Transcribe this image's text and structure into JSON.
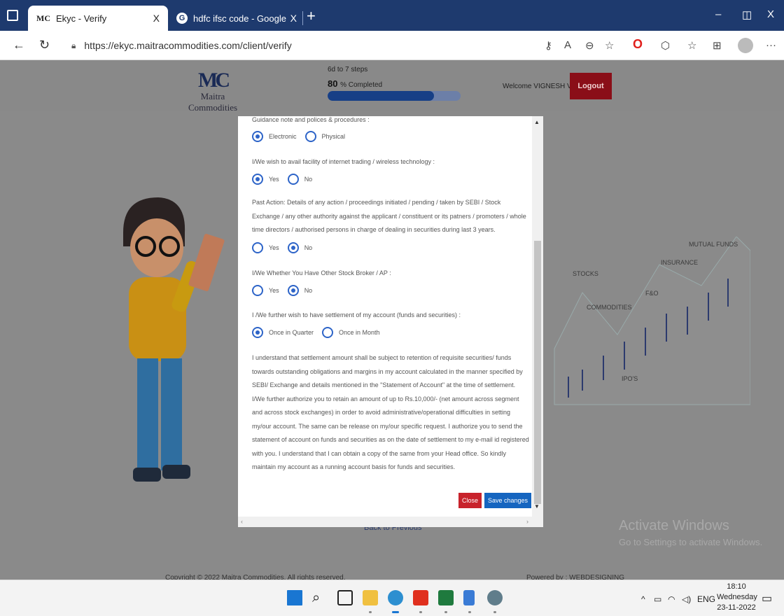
{
  "browser": {
    "tabs": [
      {
        "favicon": "MC",
        "title": "Ekyc - Verify",
        "close": "X",
        "active": true
      },
      {
        "favicon": "G",
        "title": "hdfc ifsc code - Google Search",
        "close": "X",
        "active": false
      }
    ],
    "new_tab": "+",
    "window_controls": {
      "minimize": "–",
      "restore": "◫",
      "close": "X"
    },
    "url": "https://ekyc.maitracommodities.com/client/verify",
    "toolbar_icons": [
      "key-icon",
      "read-aloud-icon",
      "zoom-icon",
      "favorite-add-icon",
      "opera-icon",
      "extensions-icon",
      "favorites-icon",
      "collections-icon",
      "profile-icon",
      "more-icon"
    ]
  },
  "header": {
    "logo_mark": "MC",
    "logo_name": "Maitra Commodities",
    "steps": "6d to 7 steps",
    "percent": "80",
    "percent_suffix": "% Completed",
    "progress_fraction": 0.8,
    "welcome": "Welcome VIGNESH V",
    "logout": "Logout"
  },
  "illustration": {
    "labels": {
      "mutual_funds": "MUTUAL FUNDS",
      "insurance": "INSURANCE",
      "stocks": "STOCKS",
      "fo": "F&O",
      "commodities": "COMMODITIES",
      "ipos": "IPO'S"
    }
  },
  "modal": {
    "q1": {
      "text": "Guidance note and polices & procedures :",
      "options": [
        "Electronic",
        "Physical"
      ],
      "selected": 0
    },
    "q2": {
      "text": "I/We wish to avail facility of internet trading / wireless technology :",
      "options": [
        "Yes",
        "No"
      ],
      "selected": 0
    },
    "q3": {
      "text": "Past Action: Details of any action / proceedings initiated / pending / taken by SEBI / Stock Exchange / any other authority against the applicant / constituent or its patners / promoters / whole time directors / authorised persons in charge of dealing in securities during last 3 years.",
      "options": [
        "Yes",
        "No"
      ],
      "selected": 1
    },
    "q4": {
      "text": "I/We Whether You Have Other Stock Broker / AP :",
      "options": [
        "Yes",
        "No"
      ],
      "selected": 1
    },
    "q5": {
      "text": "I /We further wish to have settlement of my account (funds and securities) :",
      "options": [
        "Once in Quarter",
        "Once in Month"
      ],
      "selected": 0
    },
    "disclaimer": "I understand that settlement amount shall be subject to retention of requisite securities/ funds towards outstanding obligations and margins in my account calculated in the manner specified by SEBI/ Exchange and details mentioned in the \"Statement of Account\" at the time of settlement. I/We further authorize you to retain an amount of up to Rs.10,000/- (net amount across segment and across stock exchanges) in order to avoid administrative/operational difficulties in setting my/our account. The same can be release on my/our specific request. I authorize you to send the statement of account on funds and securities as on the date of settlement to my e-mail id registered with you. I understand that I can obtain a copy of the same from your Head office. So kindly maintain my account as a running account basis for funds and securities.",
    "close_label": "Close",
    "save_label": "Save changes"
  },
  "page": {
    "back_to_previous": "Back to Previous",
    "copyright": "Copyright © 2022 Maitra Commodities. All rights reserved.",
    "powered_by": "Powered by : WEBDESIGNING",
    "activate_title": "Activate Windows",
    "activate_sub": "Go to Settings to activate Windows."
  },
  "taskbar": {
    "apps": [
      "windows-start-icon",
      "search-icon",
      "task-view-icon",
      "file-explorer-icon",
      "edge-icon",
      "app-red-icon",
      "excel-icon",
      "notepad-icon",
      "settings-icon"
    ],
    "tray": {
      "chevron": "^",
      "lang": "ENG"
    },
    "time": "18:10",
    "day": "Wednesday",
    "date": "23-11-2022"
  }
}
